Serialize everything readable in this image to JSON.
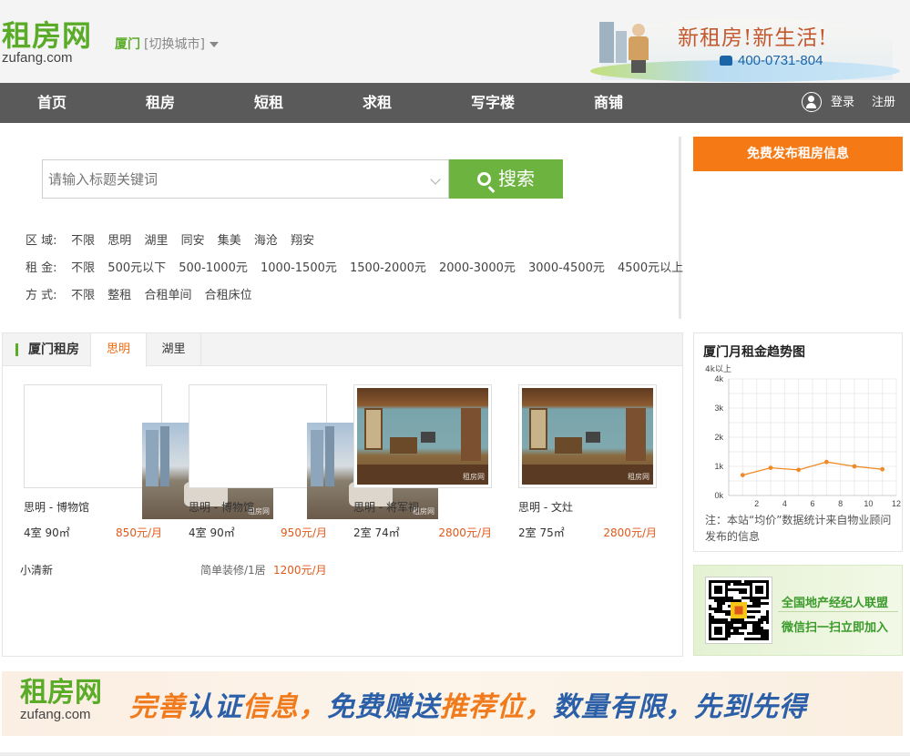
{
  "header": {
    "logo_cn": "租房网",
    "logo_en": "zufang.com",
    "city": "厦门",
    "switch_city": "[切换城市]",
    "slogan": "新租房!新生活!",
    "phone": "400-0731-804"
  },
  "nav": {
    "items": [
      "首页",
      "租房",
      "短租",
      "求租",
      "写字楼",
      "商铺"
    ],
    "login": "登录",
    "register": "注册"
  },
  "search": {
    "placeholder": "请输入标题关键词",
    "button": "搜索"
  },
  "filters": {
    "district": {
      "label": "区  域:",
      "options": [
        "不限",
        "思明",
        "湖里",
        "同安",
        "集美",
        "海沧",
        "翔安"
      ]
    },
    "rent": {
      "label": "租  金:",
      "options": [
        "不限",
        "500元以下",
        "500-1000元",
        "1000-1500元",
        "1500-2000元",
        "2000-3000元",
        "3000-4500元",
        "4500元以上"
      ]
    },
    "mode": {
      "label": "方  式:",
      "options": [
        "不限",
        "整租",
        "合租单间",
        "合租床位"
      ]
    }
  },
  "post_button": "免费发布租房信息",
  "listings": {
    "title": "厦门租房",
    "tabs": [
      "思明",
      "湖里"
    ],
    "cards": [
      {
        "location": "思明 - 博物馆",
        "rooms": "4室 90㎡",
        "price": "850元/月",
        "watermark": "租房网",
        "image": "city"
      },
      {
        "location": "思明 - 博物馆",
        "rooms": "4室 90㎡",
        "price": "950元/月",
        "watermark": "租房网",
        "image": "city"
      },
      {
        "location": "思明 - 将军祠",
        "rooms": "2室 74㎡",
        "price": "2800元/月",
        "watermark": "租房网",
        "image": "room"
      },
      {
        "location": "思明 - 文灶",
        "rooms": "2室 75㎡",
        "price": "2800元/月",
        "watermark": "租房网",
        "image": "room"
      }
    ],
    "row": {
      "name": "小清新",
      "desc": "简单装修/1居",
      "price": "1200元/月"
    }
  },
  "trend": {
    "title": "厦门月租金趋势图",
    "note": "注：本站“均价”数据统计来自物业顾问发布的信息",
    "chart_data": {
      "type": "line",
      "x": [
        1,
        3,
        5,
        7,
        9,
        11
      ],
      "values": [
        0.7,
        0.95,
        0.88,
        1.15,
        1.0,
        0.9
      ],
      "x_ticks": [
        "2",
        "4",
        "6",
        "8",
        "10",
        "12"
      ],
      "y_ticks": [
        "0k",
        "1k",
        "2k",
        "3k",
        "4k"
      ],
      "y_top_label": "4k以上",
      "ylim": [
        0,
        4
      ],
      "xlim": [
        0,
        12
      ],
      "color": "#f08a24"
    }
  },
  "qr_promo": {
    "line1": "全国地产经纪人联盟",
    "line2": "微信扫一扫立即加入"
  },
  "bottom_banner": {
    "logo_cn": "租房网",
    "logo_en": "zufang.com",
    "parts": [
      "完善",
      "认证",
      "信息，",
      "免费",
      "赠送",
      "推荐位",
      "，",
      "数量有限，先到先得"
    ]
  }
}
